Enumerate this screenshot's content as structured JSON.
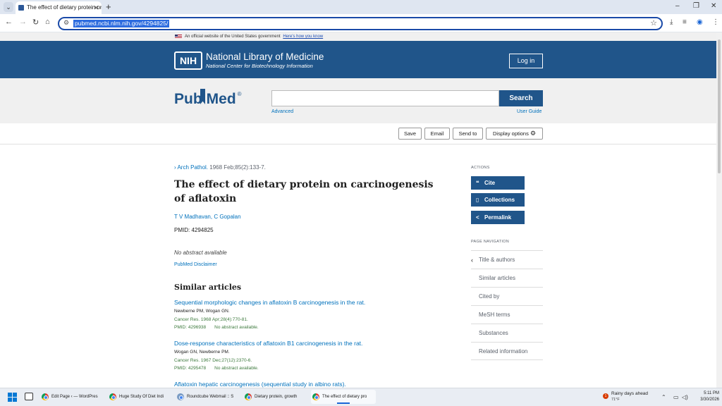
{
  "browser": {
    "tab_title": "The effect of dietary protein on",
    "new_tab": "+",
    "url": "pubmed.ncbi.nlm.nih.gov/4294825/",
    "window_controls": [
      "–",
      "❐",
      "✕"
    ]
  },
  "gov_banner": {
    "text": "An official website of the United States government",
    "link": "Here's how you know"
  },
  "header": {
    "logo": "NIH",
    "title": "National Library of Medicine",
    "subtitle": "National Center for Biotechnology Information",
    "login": "Log in"
  },
  "search": {
    "logo_pub": "Pub",
    "logo_med": "Med",
    "logo_reg": "®",
    "placeholder": "",
    "button": "Search",
    "advanced": "Advanced",
    "user_guide": "User Guide"
  },
  "actions_bar": {
    "save": "Save",
    "email": "Email",
    "send_to": "Send to",
    "display_options": "Display options"
  },
  "article": {
    "journal": "Arch Pathol.",
    "citation": " 1968 Feb;85(2):133-7.",
    "title": "The effect of dietary protein on carcinogenesis of aflatoxin",
    "authors": "T V Madhavan, C Gopalan",
    "pmid": "PMID: 4294825",
    "no_abstract": "No abstract available",
    "disclaimer": "PubMed Disclaimer"
  },
  "similar": {
    "heading": "Similar articles",
    "items": [
      {
        "title": "Sequential morphologic changes in aflatoxin B carcinogenesis in the rat.",
        "authors": "Newberne PM, Wogan GN.",
        "journal": "Cancer Res. 1968 Apr;28(4):770-81.",
        "pmid": "PMID: 4296938",
        "note": "No abstract available."
      },
      {
        "title": "Dose-response characteristics of aflatoxin B1 carcinogenesis in the rat.",
        "authors": "Wogan GN, Newberne PM.",
        "journal": "Cancer Res. 1967 Dec;27(12):2370-6.",
        "pmid": "PMID: 4295478",
        "note": "No abstract available."
      },
      {
        "title": "Aflatoxin hepatic carcinogenesis (sequential study in albino rats).",
        "authors": "",
        "journal": "",
        "pmid": "",
        "note": ""
      }
    ]
  },
  "sidebar": {
    "actions_label": "ACTIONS",
    "cite": "Cite",
    "collections": "Collections",
    "permalink": "Permalink",
    "page_nav_label": "PAGE NAVIGATION",
    "nav": [
      "Title & authors",
      "Similar articles",
      "Cited by",
      "MeSH terms",
      "Substances",
      "Related information"
    ]
  },
  "taskbar": {
    "apps": [
      "Edit Page ‹ — WordPres",
      "Huge Study Of Diet Indi",
      "Roundcube Webmail :: S",
      "Dietary protein, growth",
      "The effect of dietary pro"
    ],
    "weather_title": "Rainy days ahead",
    "weather_temp": "71°F",
    "weather_badge": "1",
    "time": "5:11 PM",
    "date": "3/30/2026"
  },
  "colors": {
    "nlm_blue": "#20558a",
    "link_blue": "#0071bc",
    "citation_green": "#3d7a3d",
    "banner_gray": "#f0f0f0"
  }
}
